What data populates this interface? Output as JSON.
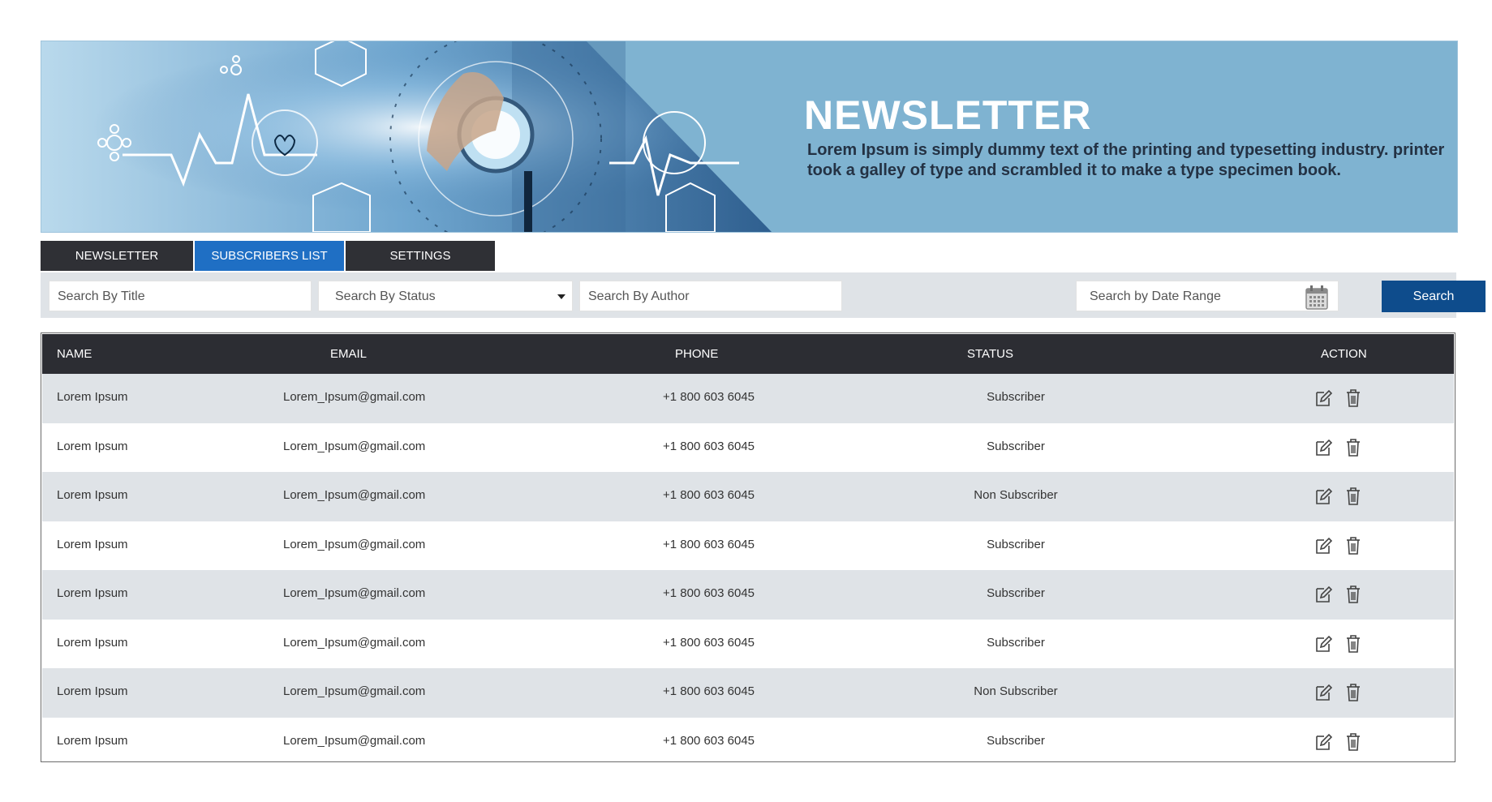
{
  "banner": {
    "title": "NEWSLETTER",
    "description": "Lorem Ipsum is simply dummy text of the printing and typesetting industry. printer took a galley of type and scrambled it to make a type specimen book."
  },
  "tabs": [
    {
      "label": "NEWSLETTER",
      "active": false
    },
    {
      "label": "SUBSCRIBERS LIST",
      "active": true
    },
    {
      "label": "SETTINGS",
      "active": false
    }
  ],
  "search": {
    "title_placeholder": "Search By Title",
    "status_value": "Search By Status",
    "author_placeholder": "Search By Author",
    "date_placeholder": "Search by Date Range",
    "button_label": "Search"
  },
  "table": {
    "headers": {
      "name": "NAME",
      "email": "EMAIL",
      "phone": "PHONE",
      "status": "STATUS",
      "action": "ACTION"
    },
    "rows": [
      {
        "name": "Lorem Ipsum",
        "email": "Lorem_Ipsum@gmail.com",
        "phone": "+1 800 603 6045",
        "status": "Subscriber"
      },
      {
        "name": "Lorem Ipsum",
        "email": "Lorem_Ipsum@gmail.com",
        "phone": "+1 800 603 6045",
        "status": "Subscriber"
      },
      {
        "name": "Lorem Ipsum",
        "email": "Lorem_Ipsum@gmail.com",
        "phone": "+1 800 603 6045",
        "status": "Non Subscriber"
      },
      {
        "name": "Lorem Ipsum",
        "email": "Lorem_Ipsum@gmail.com",
        "phone": "+1 800 603 6045",
        "status": "Subscriber"
      },
      {
        "name": "Lorem Ipsum",
        "email": "Lorem_Ipsum@gmail.com",
        "phone": "+1 800 603 6045",
        "status": "Subscriber"
      },
      {
        "name": "Lorem Ipsum",
        "email": "Lorem_Ipsum@gmail.com",
        "phone": "+1 800 603 6045",
        "status": "Subscriber"
      },
      {
        "name": "Lorem Ipsum",
        "email": "Lorem_Ipsum@gmail.com",
        "phone": "+1 800 603 6045",
        "status": "Non Subscriber"
      },
      {
        "name": "Lorem Ipsum",
        "email": "Lorem_Ipsum@gmail.com",
        "phone": "+1 800 603 6045",
        "status": "Subscriber"
      }
    ],
    "action_icons": [
      "edit-icon",
      "trash-icon"
    ]
  },
  "colors": {
    "banner_bg": "#7fb3d1",
    "tab_dark": "#2f3035",
    "tab_active": "#1f6fc4",
    "search_button": "#0e4c8c",
    "table_header": "#2c2d33",
    "row_alt": "#dfe3e7"
  }
}
